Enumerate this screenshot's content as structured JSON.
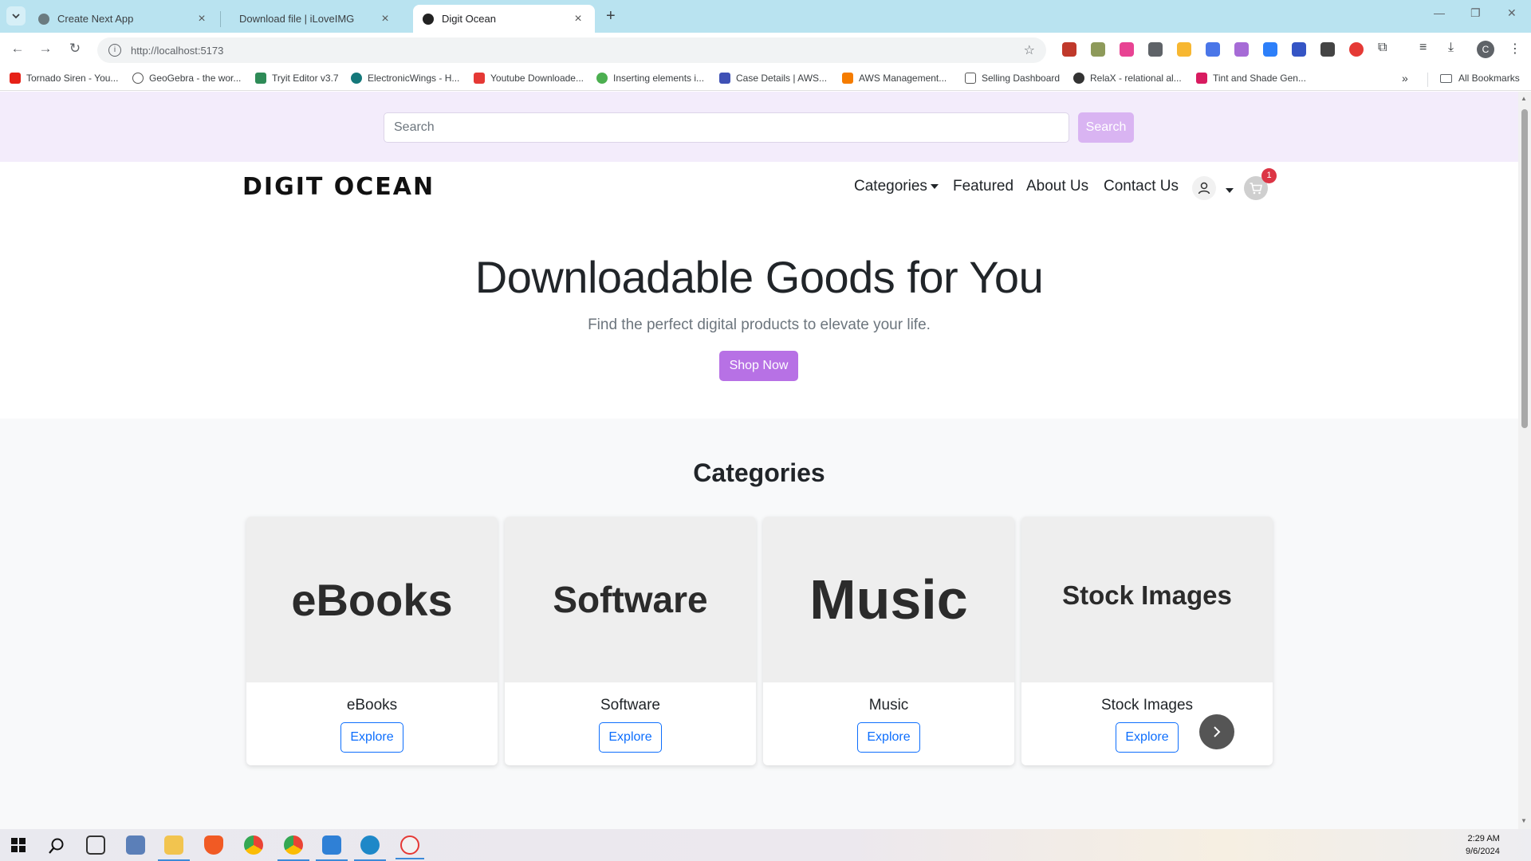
{
  "browser": {
    "tabs": [
      {
        "title": "Create Next App",
        "active": false
      },
      {
        "title": "Download file | iLoveIMG",
        "active": false
      },
      {
        "title": "Digit Ocean",
        "active": true
      }
    ],
    "url": "http://localhost:5173",
    "bookmarks": [
      "Tornado Siren - You...",
      "GeoGebra - the wor...",
      "Tryit Editor v3.7",
      "ElectronicWings - H...",
      "Youtube Downloade...",
      "Inserting elements i...",
      "Case Details | AWS...",
      "AWS Management...",
      "Selling Dashboard",
      "RelaX - relational al...",
      "Tint and Shade Gen..."
    ],
    "all_bookmarks": "All Bookmarks",
    "profile_initial": "C"
  },
  "search": {
    "placeholder": "Search",
    "button": "Search"
  },
  "nav": {
    "brand": "DIGIT OCEAN",
    "categories": "Categories",
    "featured": "Featured",
    "about": "About Us",
    "contact": "Contact Us",
    "cart_count": "1"
  },
  "hero": {
    "title": "Downloadable Goods for You",
    "subtitle": "Find the perfect digital products to elevate your life.",
    "cta": "Shop Now"
  },
  "categories": {
    "heading": "Categories",
    "items": [
      {
        "image_text": "eBooks",
        "title": "eBooks",
        "button": "Explore"
      },
      {
        "image_text": "Software",
        "title": "Software",
        "button": "Explore"
      },
      {
        "image_text": "Music",
        "title": "Music",
        "button": "Explore"
      },
      {
        "image_text": "Stock Images",
        "title": "Stock Images",
        "button": "Explore"
      }
    ]
  },
  "taskbar": {
    "time": "2:29 AM",
    "date": "9/6/2024"
  },
  "colors": {
    "accent": "#b771e5",
    "search_band": "#f3ecfb",
    "explore_blue": "#0d6efd",
    "badge_red": "#dc3545"
  }
}
